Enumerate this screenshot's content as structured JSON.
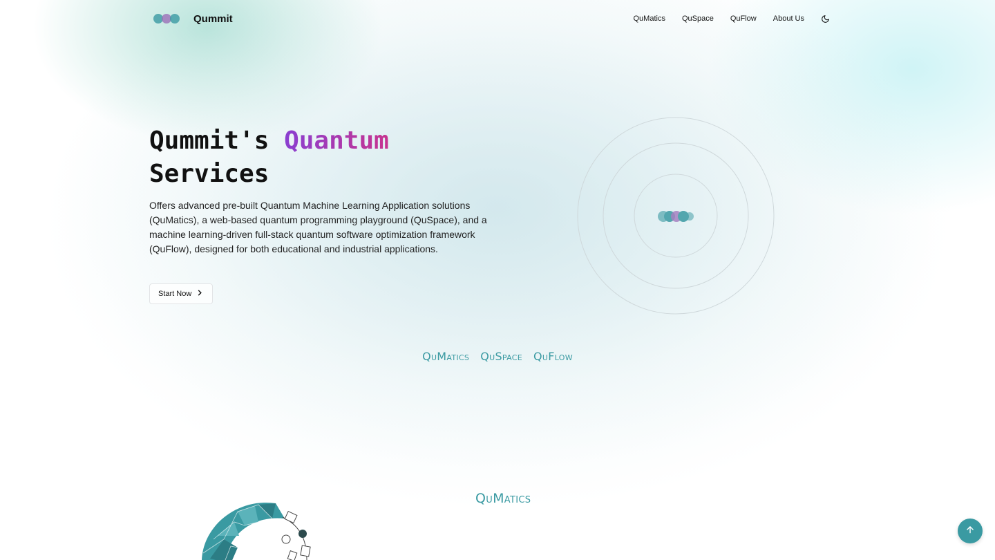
{
  "header": {
    "brand": "Qummit",
    "logo_icon": "logo-dots-icon",
    "nav": [
      "QuMatics",
      "QuSpace",
      "QuFlow",
      "About Us"
    ],
    "theme_icon": "moon-icon"
  },
  "hero": {
    "title_part1": "Qummit's",
    "title_accent": "Quantum",
    "title_part2": "Services",
    "description": "Offers advanced pre-built Quantum Machine Learning Application solutions (QuMatics), a web-based quantum programming playground (QuSpace), and a machine learning-driven full-stack quantum software optimization framework (QuFlow), designed for both educational and industrial applications.",
    "cta_label": "Start Now",
    "cta_icon": "chevron-right-icon"
  },
  "products": [
    "QuMatics",
    "QuSpace",
    "QuFlow"
  ],
  "section": {
    "title": "QuMatics"
  },
  "scroll_top_icon": "arrow-up-icon",
  "colors": {
    "teal": "#3a9aa2",
    "accent_purple": "#8a3fd1",
    "accent_magenta": "#c7338f"
  }
}
